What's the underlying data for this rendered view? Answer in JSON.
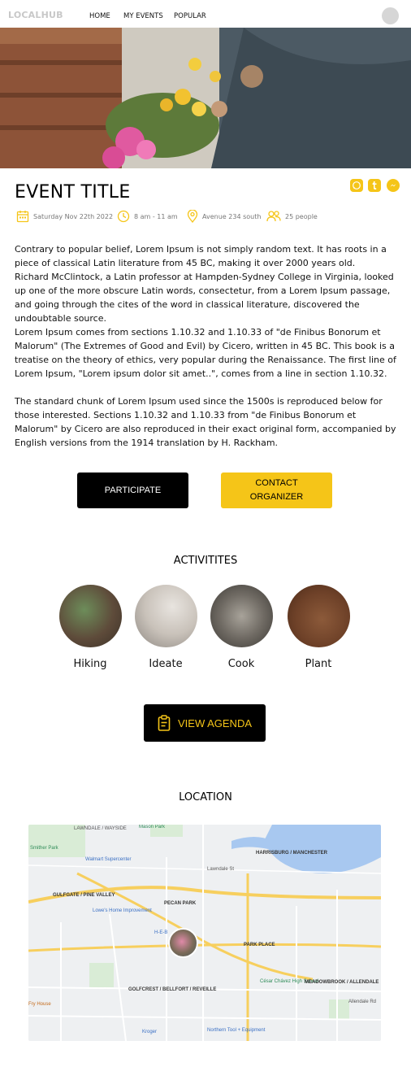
{
  "nav": {
    "logo": "LOCALHUB",
    "links": [
      "HOME",
      "MY EVENTS",
      "POPULAR"
    ]
  },
  "event": {
    "title": "EVENT TITLE",
    "date": "Saturday Nov 22th 2022",
    "time": "8 am - 11 am",
    "location": "Avenue 234 south",
    "people": "25 people"
  },
  "description": {
    "paragraph1": "Contrary to popular belief, Lorem Ipsum is not simply random text. It has roots in a piece of classical Latin literature from 45 BC, making it over 2000 years old.",
    "paragraph2": "Richard McClintock, a Latin professor at Hampden-Sydney College in Virginia, looked up one of the more obscure Latin words, consectetur, from a Lorem Ipsum passage, and going through the cites of  the word in classical literature, discovered the undoubtable source.",
    "paragraph3": "Lorem Ipsum comes from sections 1.10.32 and 1.10.33 of \"de Finibus Bonorum et Malorum\" (The Extremes of Good and Evil) by Cicero, written in 45 BC. This book is a treatise on the theory of ethics, very popular during the Renaissance. The first line of Lorem Ipsum, \"Lorem ipsum dolor sit amet..\", comes from a line in section 1.10.32.",
    "paragraph4": "The standard chunk of Lorem Ipsum used since the 1500s is reproduced below for those interested. Sections 1.10.32 and 1.10.33 from \"de Finibus Bonorum et Malorum\" by Cicero are also reproduced in their exact original form, accompanied by English versions from the 1914 translation by H. Rackham."
  },
  "actions": {
    "participate": "PARTICIPATE",
    "contact_line1": "CONTACT",
    "contact_line2": "ORGANIZER",
    "agenda": "VIEW AGENDA"
  },
  "activities": {
    "title": "ACTIVITITES",
    "items": [
      {
        "label": "Hiking"
      },
      {
        "label": "Ideate"
      },
      {
        "label": "Cook"
      },
      {
        "label": "Plant"
      }
    ]
  },
  "location": {
    "title": "LOCATION",
    "map_labels": {
      "lawndale": "LAWNDALE / WAYSIDE",
      "mason_park": "Mason Park",
      "smither_park": "Smither Park",
      "walmart": "Walmart Supercenter",
      "harrisburg": "HARRISBURG / MANCHESTER",
      "lawndale_st": "Lawndale St",
      "gulfgate": "GULFGATE / PINE VALLEY",
      "pecan_park": "PECAN PARK",
      "lowes": "Lowe's Home Improvement",
      "heb": "H-E-B",
      "park_place": "PARK PLACE",
      "cesar_chavez": "César Chávez High School",
      "meadowbrook": "MEADOWBROOK / ALLENDALE",
      "golfcrest": "GOLFCREST / BELLFORT / REVEILLE",
      "fry_house": "Fry House",
      "kroger": "Kroger",
      "northern_tool": "Northern Tool + Equipment",
      "allendale_rd": "Allendale Rd"
    }
  },
  "colors": {
    "accent": "#f5c518",
    "button_dark": "#000000"
  }
}
